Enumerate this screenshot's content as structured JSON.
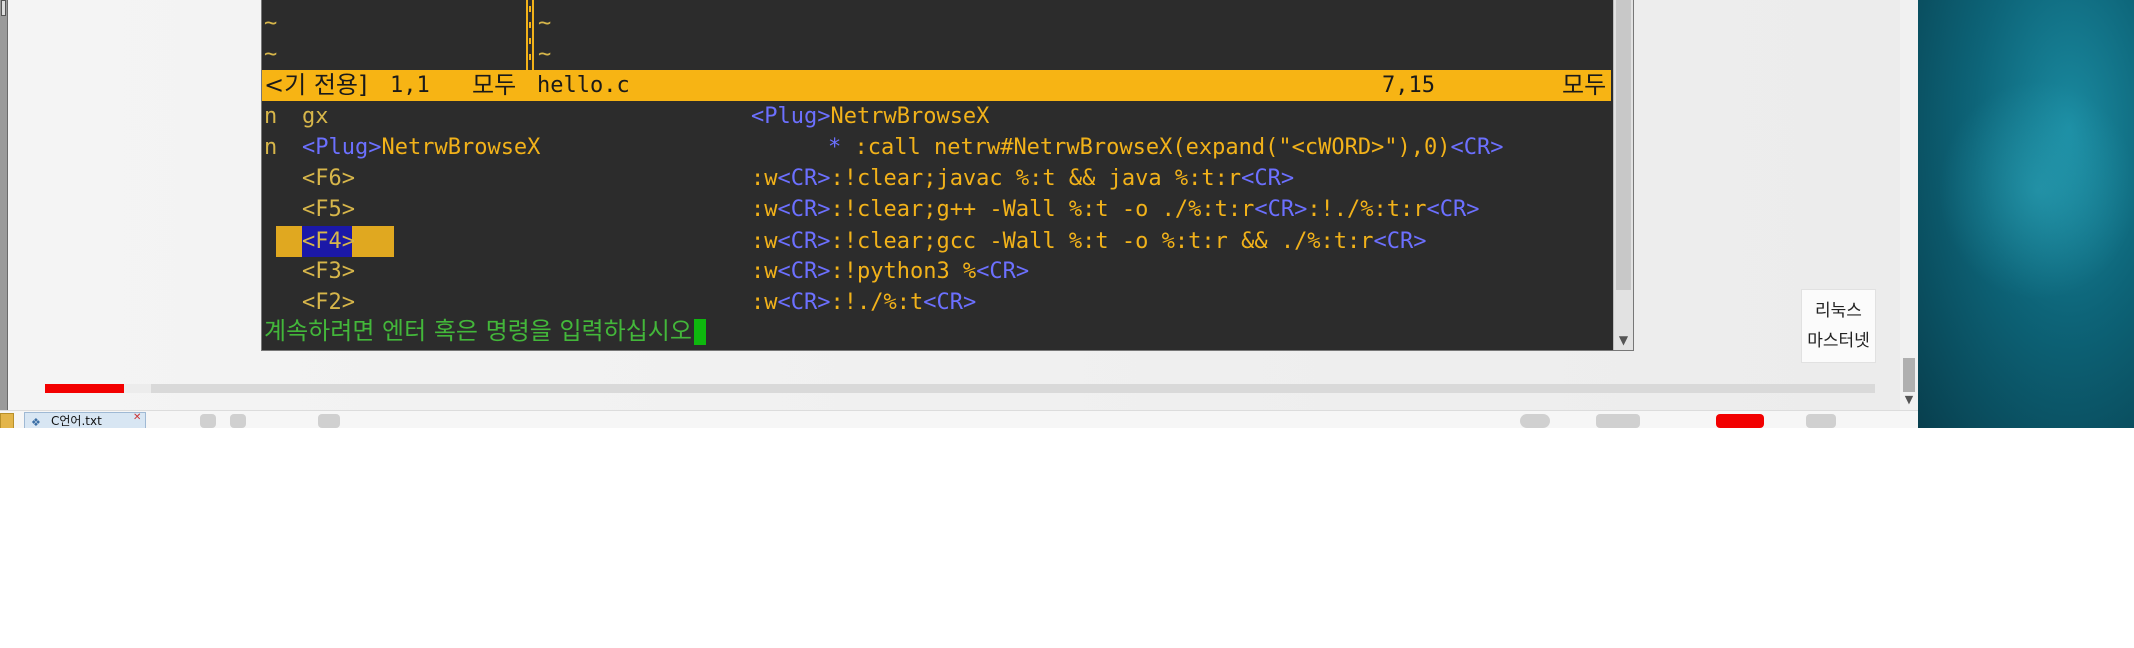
{
  "vim": {
    "tilde_rows": [
      "~",
      "~"
    ],
    "statusline": {
      "left_name": "<기 전용]",
      "left_pos": "1,1",
      "left_pct": "모두",
      "right_name": "hello.c",
      "right_pos": "7,15",
      "right_pct": "모두"
    },
    "mappings": [
      {
        "mode": "n",
        "lhs": "gx",
        "rhs": [
          {
            "t": "<Plug>",
            "c": "spec"
          },
          {
            "t": "NetrwBrowseX",
            "c": "yel"
          }
        ]
      },
      {
        "mode": "n",
        "lhs": "<Plug>NetrwBrowseX",
        "rhs": [
          {
            "t": "* ",
            "c": "spec"
          },
          {
            "t": ":call netrw#NetrwBrowseX(expand(\"<cWORD>\"),0)",
            "c": "yel"
          },
          {
            "t": "<CR>",
            "c": "spec"
          }
        ]
      },
      {
        "mode": "",
        "lhs": "<F6>",
        "rhs": [
          {
            "t": ":w",
            "c": "yel"
          },
          {
            "t": "<CR>",
            "c": "spec"
          },
          {
            "t": ":!clear;javac %:t && java %:t:r",
            "c": "yel"
          },
          {
            "t": "<CR>",
            "c": "spec"
          }
        ]
      },
      {
        "mode": "",
        "lhs": "<F5>",
        "rhs": [
          {
            "t": ":w",
            "c": "yel"
          },
          {
            "t": "<CR>",
            "c": "spec"
          },
          {
            "t": ":!clear;g++ -Wall %:t -o ./%:t:r",
            "c": "yel"
          },
          {
            "t": "<CR>",
            "c": "spec"
          },
          {
            "t": ":!./%:t:r",
            "c": "yel"
          },
          {
            "t": "<CR>",
            "c": "spec"
          }
        ]
      },
      {
        "mode": "",
        "lhs": "<F4>",
        "rhs": [
          {
            "t": ":w",
            "c": "yel"
          },
          {
            "t": "<CR>",
            "c": "spec"
          },
          {
            "t": ":!clear;gcc -Wall %:t -o %:t:r && ./%:t:r",
            "c": "yel"
          },
          {
            "t": "<CR>",
            "c": "spec"
          }
        ]
      },
      {
        "mode": "",
        "lhs": "<F3>",
        "rhs": [
          {
            "t": ":w",
            "c": "yel"
          },
          {
            "t": "<CR>",
            "c": "spec"
          },
          {
            "t": ":!python3 %",
            "c": "yel"
          },
          {
            "t": "<CR>",
            "c": "spec"
          }
        ]
      },
      {
        "mode": "",
        "lhs": "<F2>",
        "rhs": [
          {
            "t": ":w",
            "c": "yel"
          },
          {
            "t": "<CR>",
            "c": "spec"
          },
          {
            "t": ":!./%:t",
            "c": "yel"
          },
          {
            "t": "<CR>",
            "c": "spec"
          }
        ]
      }
    ],
    "prompt": "계속하려면 엔터 혹은 명령을 입력하십시오"
  },
  "watermark": {
    "line1": "리눅스",
    "line2": "마스터넷"
  },
  "video": {
    "played_fraction": 0.043,
    "buffered_fraction": 0.058
  },
  "taskbar": {
    "tab_label": "C언어.txt"
  },
  "colors": {
    "terminal_bg": "#2c2c2c",
    "statusline_bg": "#f7b414",
    "special_key": "#6c70ff",
    "text_yellow": "#f2b21a",
    "prompt_green": "#43b73a",
    "progress_red": "#f30000"
  }
}
